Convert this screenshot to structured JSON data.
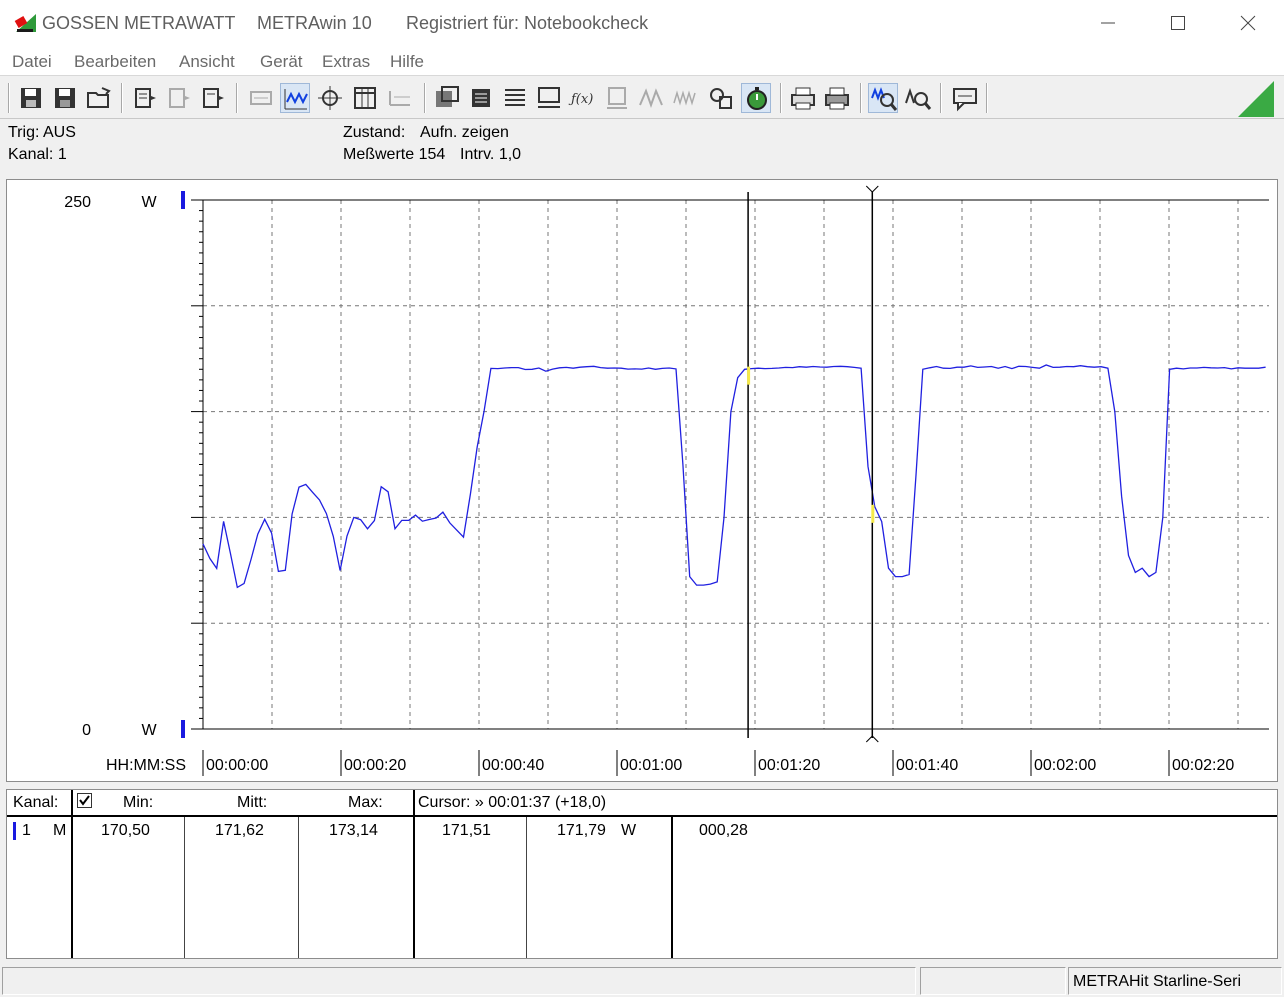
{
  "window": {
    "brand": "GOSSEN METRAWATT",
    "app": "METRAwin 10",
    "registered": "Registriert für: Notebookcheck",
    "controls": [
      "minimize-icon",
      "maximize-icon",
      "close-icon"
    ]
  },
  "menu": [
    "Datei",
    "Bearbeiten",
    "Ansicht",
    "Gerät",
    "Extras",
    "Hilfe"
  ],
  "toolbar_icons": [
    "save-icon",
    "save-as-icon",
    "open-folder-icon",
    "device-read-icon",
    "device-transfer-icon",
    "device-write-icon",
    "memo-icon",
    "waveform-icon",
    "crosshair-icon",
    "table-icon",
    "bar-grid-icon",
    "chart-settings-icon",
    "channel-icon",
    "list-icon",
    "monitor-icon",
    "formula-icon",
    "memory-icon",
    "wave-analysis-icon",
    "wave-filter-icon",
    "copy-measure-icon",
    "stopwatch-icon",
    "print-preview-icon",
    "print-icon",
    "zoom-in-icon",
    "zoom-out-icon",
    "info-icon"
  ],
  "info": {
    "trig": "Trig: AUS",
    "kanal": "Kanal: 1",
    "zustand_label": "Zustand:",
    "zustand_value": "Aufn. zeigen",
    "messwerte": "Meßwerte 154",
    "intervall": "Intrv. 1,0"
  },
  "chart_data": {
    "type": "line",
    "y_top_label": "250",
    "y_bottom_label": "0",
    "y_unit": "W",
    "ylim": [
      0,
      250
    ],
    "xlim": [
      0,
      154
    ],
    "x_axis_label": "HH:MM:SS",
    "x_ticks": [
      "00:00:00",
      "00:00:20",
      "00:00:40",
      "00:01:00",
      "00:01:20",
      "00:01:40",
      "00:02:00",
      "00:02:20"
    ],
    "grid": true,
    "cursors_s": [
      79,
      97
    ],
    "line_color": "#2020e0",
    "series": [
      {
        "values": [
          87.5,
          80.6,
          75.9,
          98.1,
          83.1,
          66.9,
          68.8,
          80.1,
          92.1,
          99.1,
          92.6,
          74.5,
          75.0,
          101.6,
          114.3,
          115.6,
          111.8,
          108.2,
          101.8,
          91.0,
          74.9,
          91.2,
          100.0,
          98.9,
          94.6,
          98.5,
          114.5,
          112.1,
          94.6,
          98.6,
          98.6,
          101.1,
          98.2,
          99.0,
          99.7,
          102.5,
          97.4,
          94.0,
          90.7,
          111.0,
          133.3,
          150.3,
          170.4,
          170.3,
          170.6,
          170.8,
          170.8,
          169.9,
          170.0,
          170.6,
          169.1,
          170.1,
          170.7,
          170.9,
          170.5,
          171.0,
          171.2,
          171.4,
          170.8,
          170.5,
          170.6,
          170.5,
          170.1,
          170.2,
          170.1,
          170.6,
          170.0,
          170.4,
          170.6,
          170.2,
          125.0,
          72.0,
          68.0,
          68.0,
          68.5,
          69.5,
          100.0,
          150.0,
          166.0,
          170.0,
          170.3,
          170.5,
          170.3,
          170.4,
          170.6,
          170.9,
          170.8,
          171.2,
          171.0,
          171.3,
          171.1,
          171.0,
          171.3,
          171.4,
          171.2,
          170.9,
          170.5,
          124.0,
          105.0,
          98.0,
          76.0,
          72.0,
          72.0,
          73.0,
          120.0,
          170.0,
          170.7,
          171.3,
          170.5,
          170.4,
          171.0,
          171.0,
          171.6,
          170.9,
          171.1,
          171.3,
          170.5,
          171.3,
          170.3,
          171.4,
          171.3,
          170.9,
          170.5,
          172.0,
          170.9,
          171.0,
          171.3,
          171.2,
          171.7,
          171.2,
          171.0,
          171.2,
          170.5,
          150.0,
          110.0,
          82.0,
          74.0,
          76.0,
          72.0,
          74.0,
          100.0,
          170.0,
          170.5,
          170.2,
          170.6,
          170.6,
          170.9,
          170.7,
          170.6,
          170.8,
          170.2,
          170.7,
          170.5,
          170.5,
          170.5,
          171.0
        ]
      }
    ]
  },
  "table": {
    "headers": {
      "kanal": "Kanal:",
      "min": "Min:",
      "mitt": "Mitt:",
      "max": "Max:",
      "cursor": "Cursor: » 00:01:37 (+18,0)"
    },
    "checkbox_checked": true,
    "row": {
      "channel": "1",
      "mode": "M",
      "min": "170,50",
      "mitt": "171,62",
      "max": "173,14",
      "cur1": "171,51",
      "cur2": "171,79",
      "unit": "W",
      "diff": "000,28"
    }
  },
  "status": {
    "device": "METRAHit Starline-Seri"
  }
}
